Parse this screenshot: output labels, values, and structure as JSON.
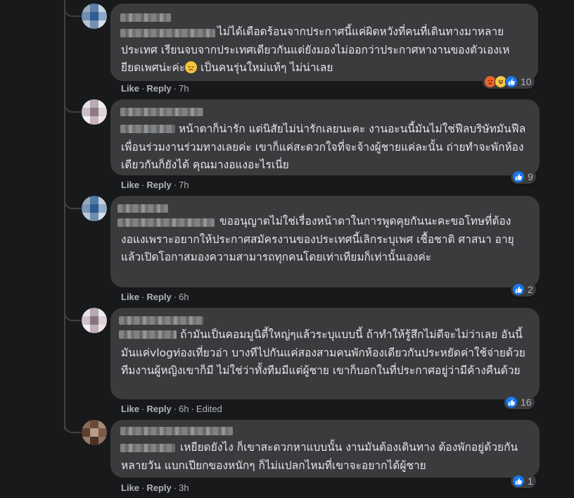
{
  "comments": [
    {
      "text": "ไม่ได้เดือดร้อนจากประกาศนี้แค่ผิดหวังที่คนที่เดินทางมาหลายประเทศ เรียนจบจากประเทศเดียวกันแต่ยังมองไม่ออกว่าประกาศหางานของตัวเองเหยียดเพศน่ะค่ะ",
      "text_tail": " เป็นคนรุ่นใหม่แท้ๆ ไม่น่าเลย",
      "like": "Like",
      "reply": "Reply",
      "time": "7h",
      "reaction_count": "10",
      "reactions": [
        "angry-icon",
        "haha-icon",
        "like-icon"
      ]
    },
    {
      "text": "หน้าตาก็น่ารัก แต่นิสัยไม่น่ารักเลยนะคะ งานอะนนี้มันไม่ใช่ฟีลบริษัทมันฟีลเพื่อนร่วมงานร่วมทางเลยค่ะ เขาก็แค่สะดวกใจที่จะจ้างผู้ชายแค่ละนั้น ถ่ายทำจะพักห้องเดียวกันก็ยังได้ คุณมางอแงอะไรเนี่ย",
      "like": "Like",
      "reply": "Reply",
      "time": "7h",
      "reaction_count": "9"
    },
    {
      "text": "ขออนุญาตไม่ใช่เรื่องหน้าตาในการพูดคุยกันนะคะขอโทษที่ต้องงอแงเพราะอยากให้ประกาศสมัครงานของประเทศนี้เลิกระบุเพศ เชื้อชาติ ศาสนา อายุ แล้วเปิดโอกาสมองความสามารถทุกคนโดยเท่าเทียมก็เท่านั้นเองค่ะ",
      "like": "Like",
      "reply": "Reply",
      "time": "6h",
      "reaction_count": "2"
    },
    {
      "text": "ถ้ามันเป็นคอมมูนิตี้ใหญ่ๆแล้วระบุแบบนี้ ถ้าทำให้รู้สึกไม่ดีจะไม่ว่าเลย อันนี้มันแค่vlogท่องเที่ยวอ่า บางทีไปกันแค่สองสามคนพักห้องเดียวกันประหยัดค่าใช้จ่ายด้วย ทีมงานผู้หญิงเขาก็มี ไม่ใช่ว่าทั้งทีมมีแต่ผู้ชาย เขาก็บอกในที่ประกาศอยู่ว่ามีค้างคืนด้วย",
      "like": "Like",
      "reply": "Reply",
      "time": "6h",
      "edited": "Edited",
      "reaction_count": "16"
    },
    {
      "text": "เหยียดยังไง ก็เขาสะดวกหาแบบนั้น งานมันต้องเดินทาง ต้องพักอยู่ด้วยกันหลายวัน แบกเปียกของหนักๆ ก็ไม่แปลกไหมที่เขาจะอยากได้ผู้ชาย",
      "like": "Like",
      "reply": "Reply",
      "time": "3h",
      "reaction_count": "1"
    }
  ],
  "colors": {
    "background": "#18191a",
    "bubble": "#3a3b3c",
    "text": "#e4e6eb",
    "secondary": "#b0b3b8",
    "like_blue": "#1877f2"
  }
}
